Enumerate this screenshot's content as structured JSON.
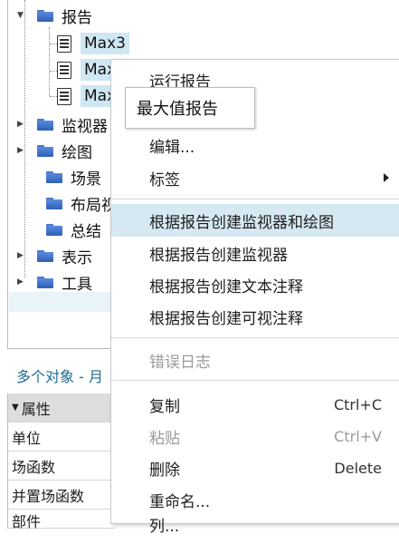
{
  "tree": {
    "items": [
      {
        "label": "报告",
        "expanded": true
      },
      {
        "label": "Max3",
        "selected": true
      },
      {
        "label": "Max",
        "selected": true
      },
      {
        "label": "Max",
        "selected": true
      },
      {
        "label": "监视器"
      },
      {
        "label": "绘图"
      },
      {
        "label": "场景"
      },
      {
        "label": "布局视"
      },
      {
        "label": "总结"
      },
      {
        "label": "表示"
      },
      {
        "label": "工具"
      }
    ]
  },
  "properties": {
    "title": "多个对象 - 月",
    "rows": [
      "属性",
      "单位",
      "场函数",
      "并置场函数",
      "部件"
    ]
  },
  "tooltip": {
    "text": "最大值报告"
  },
  "context_menu": {
    "items": [
      {
        "label": "运行报告"
      },
      {
        "label": "编辑..."
      },
      {
        "label": "标签",
        "submenu": true
      },
      {
        "label": "根据报告创建监视器和绘图",
        "highlight": true
      },
      {
        "label": "根据报告创建监视器"
      },
      {
        "label": "根据报告创建文本注释"
      },
      {
        "label": "根据报告创建可视注释"
      },
      {
        "label": "错误日志",
        "disabled": true
      },
      {
        "label": "复制",
        "shortcut": "Ctrl+C"
      },
      {
        "label": "粘贴",
        "shortcut": "Ctrl+V",
        "disabled": true
      },
      {
        "label": "删除",
        "shortcut": "Delete"
      },
      {
        "label": "重命名..."
      },
      {
        "label": "列..."
      }
    ]
  }
}
